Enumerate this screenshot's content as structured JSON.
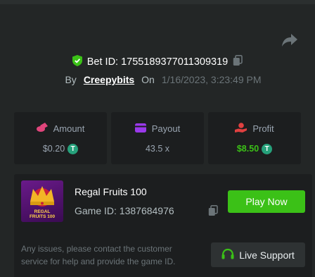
{
  "header": {
    "bet_id_text": "Bet ID: 1755189377011309319",
    "by_label": "By",
    "username": "Creepybits",
    "on_label": "On",
    "date": "1/16/2023, 3:23:49 PM",
    "icons": {
      "share": "share-icon",
      "verified": "shield-check-icon",
      "copy": "copy-icon"
    }
  },
  "stats": [
    {
      "label": "Amount",
      "value": "$0.20",
      "icon": "coins-icon",
      "icon_color": "#e0457b",
      "has_token": true,
      "value_color": "#99a4b0"
    },
    {
      "label": "Payout",
      "value": "43.5 x",
      "icon": "wallet-icon",
      "icon_color": "#9a39ea",
      "has_token": false,
      "value_color": "#99a4b0"
    },
    {
      "label": "Profit",
      "value": "$8.50",
      "icon": "hand-coin-icon",
      "icon_color": "#e04040",
      "has_token": true,
      "value_color": "#3bc117"
    }
  ],
  "token_symbol": "T",
  "game": {
    "thumb_text_line1": "REGAL",
    "thumb_text_line2": "FRUITS 100",
    "title": "Regal Fruits 100",
    "game_id_text": "Game ID: 1387684976",
    "play_label": "Play Now",
    "issues_text": "Any issues, please contact the customer service for help and provide the game ID.",
    "support_label": "Live Support"
  },
  "colors": {
    "background": "#232626",
    "card": "#1c1e1f",
    "accent_green": "#3bc117",
    "muted": "#6b7478"
  }
}
